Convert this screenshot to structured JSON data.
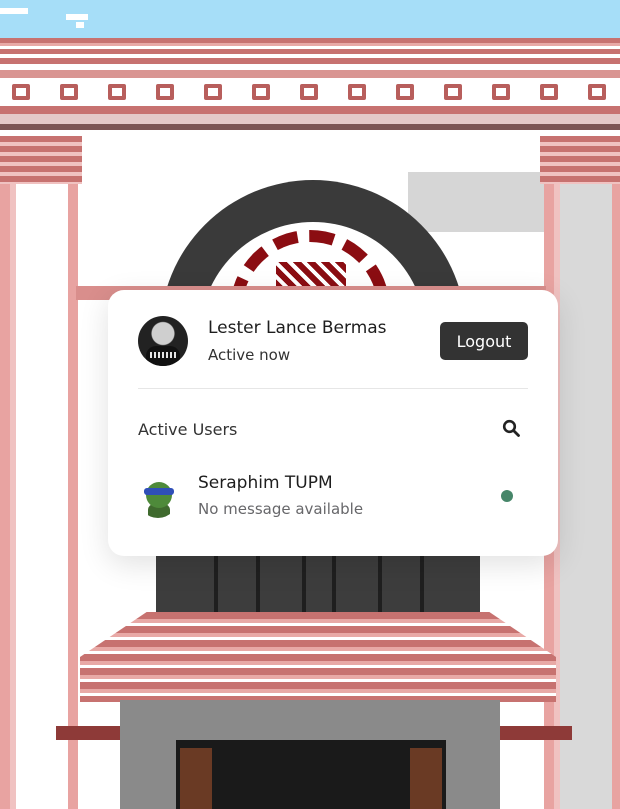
{
  "current_user": {
    "name": "Lester Lance Bermas",
    "status": "Active now",
    "avatar_icon": "user-avatar-photo"
  },
  "header": {
    "logout_label": "Logout"
  },
  "search": {
    "label": "Active Users",
    "icon": "search-icon"
  },
  "users": [
    {
      "name": "Seraphim TUPM",
      "last_message": "No message available",
      "avatar_icon": "ninja-turtle-avatar",
      "online": true,
      "status_color": "#468669"
    }
  ],
  "colors": {
    "button_bg": "#333333",
    "online_dot": "#468669",
    "card_bg": "#ffffff"
  }
}
